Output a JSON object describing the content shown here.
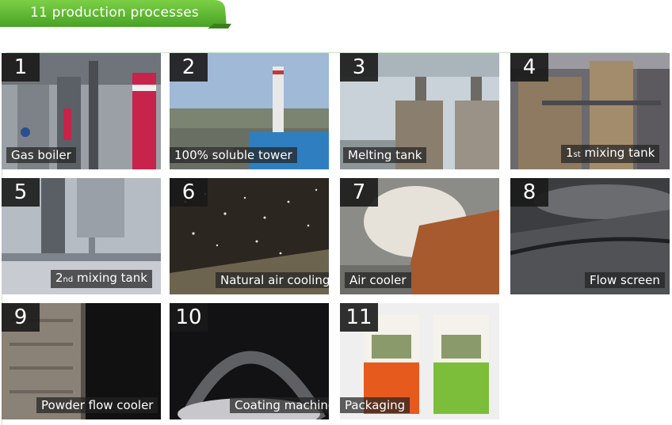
{
  "header": {
    "title": "11 production processes"
  },
  "tiles": [
    {
      "num": "1",
      "caption": "Gas boiler"
    },
    {
      "num": "2",
      "caption": "100% soluble tower"
    },
    {
      "num": "3",
      "caption": "Melting tank"
    },
    {
      "num": "4",
      "caption_pre": "1",
      "caption_sup": "st",
      "caption_post": " mixing tank"
    },
    {
      "num": "5",
      "caption_pre": "2",
      "caption_sup": "nd",
      "caption_post": " mixing tank"
    },
    {
      "num": "6",
      "caption": "Natural air cooling"
    },
    {
      "num": "7",
      "caption": "Air cooler"
    },
    {
      "num": "8",
      "caption": "Flow screen"
    },
    {
      "num": "9",
      "caption": "Powder flow cooler"
    },
    {
      "num": "10",
      "caption": "Coating machine"
    },
    {
      "num": "11",
      "caption": "Packaging"
    }
  ],
  "colors": {
    "banner_green": "#5cb531",
    "frame_green": "#c9e6c9"
  }
}
